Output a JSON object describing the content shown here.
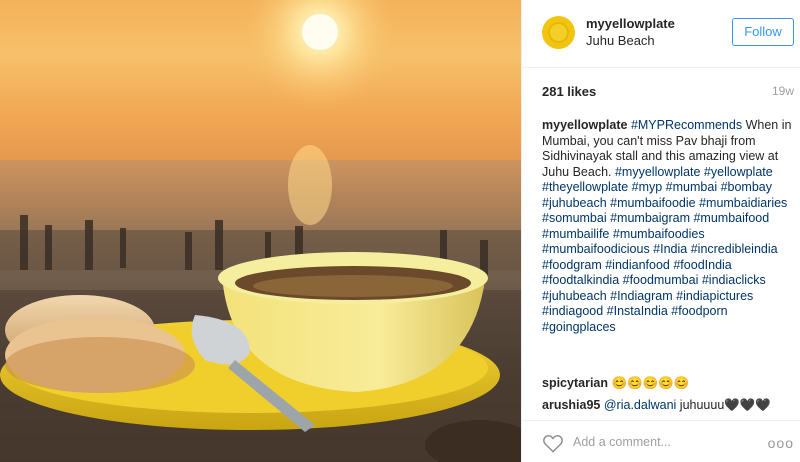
{
  "post": {
    "username": "myyellowplate",
    "location": "Juhu Beach",
    "follow_label": "Follow",
    "likes": "281 likes",
    "age": "19w",
    "caption_author": "myyellowplate",
    "caption_line1": "#MYPRecommends",
    "caption_text": "When in Mumbai, you can't miss Pav bhaji from Sidhivinayak stall and this amazing view at Juhu Beach.",
    "hashtags": [
      "#myyellowplate #yellowplate",
      "#theyellowplate #myp #mumbai",
      "#bombay #juhubeach #mumbaifoodie",
      "#mumbaidiaries #somumbai",
      "#mumbaigram #mumbaifood",
      "#mumbailife #mumbaifoodies",
      "#mumbaifoodicious #India",
      "#incredibleindia #foodgram #indianfood",
      "#foodIndia #foodtalkindia #foodmumbai",
      "#indiaclicks #juhubeach #Indiagram",
      "#indiapictures #indiagood #InstaIndia",
      "#foodporn #goingplaces"
    ]
  },
  "comments": [
    {
      "user": "spicytarian",
      "text": "😊😊😊😊😊"
    },
    {
      "user": "arushia95",
      "mention": "@ria.dalwani",
      "text": "juhuuuu🖤🖤🖤"
    }
  ],
  "footer": {
    "add_comment_placeholder": "Add a comment...",
    "more_label": "ooo"
  },
  "icons": {
    "heart": "heart-icon",
    "more": "more-options-icon"
  },
  "colors": {
    "accent": "#3897f0",
    "hashtag": "#003569",
    "muted": "#a0a0a0"
  }
}
